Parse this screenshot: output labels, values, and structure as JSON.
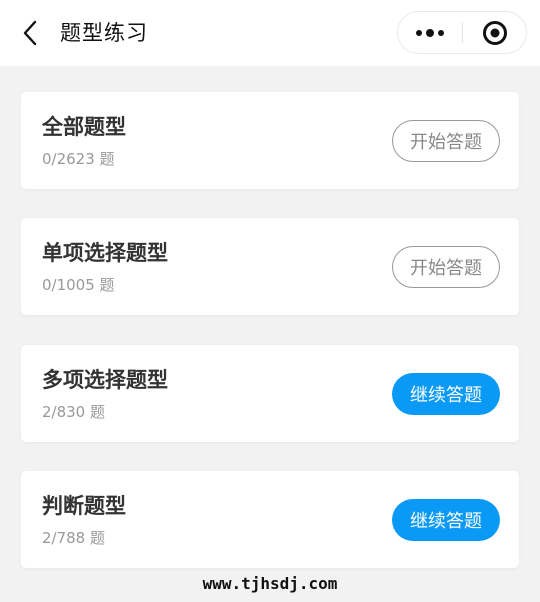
{
  "nav": {
    "title": "题型练习",
    "back_icon": "chevron-left-icon",
    "more_icon": "more-dots-icon",
    "close_icon": "target-circle-icon"
  },
  "cards": [
    {
      "title": "全部题型",
      "progress": "0/2623 题",
      "button": "开始答题",
      "button_style": "outline"
    },
    {
      "title": "单项选择题型",
      "progress": "0/1005 题",
      "button": "开始答题",
      "button_style": "outline"
    },
    {
      "title": "多项选择题型",
      "progress": "2/830 题",
      "button": "继续答题",
      "button_style": "filled"
    },
    {
      "title": "判断题型",
      "progress": "2/788 题",
      "button": "继续答题",
      "button_style": "filled"
    }
  ],
  "watermark": "www.tjhsdj.com",
  "colors": {
    "accent": "#0a9af6",
    "page_bg": "#f2f2f2",
    "title_text": "#333333",
    "secondary_text": "#999999"
  }
}
